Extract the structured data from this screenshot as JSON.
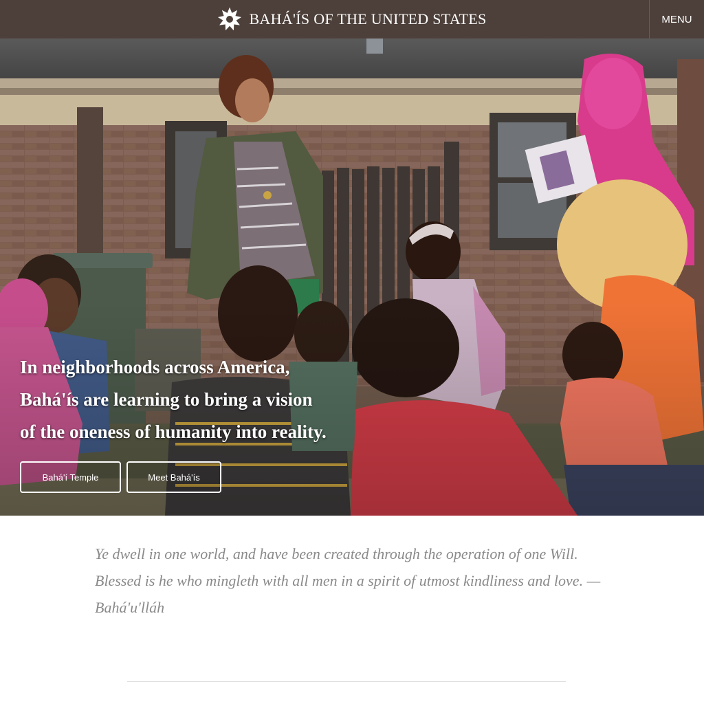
{
  "header": {
    "brand_icon": "nine-pointed-star-icon",
    "brand_title": "BAHÁ'ÍS OF THE UNITED STATES",
    "menu_label": "MENU",
    "background_color": "#4d403a"
  },
  "hero": {
    "headline_lines": [
      "In neighborhoods across America,",
      "Bahá'ís are learning to bring a vision",
      "of the oneness of humanity into reality."
    ],
    "buttons": [
      {
        "label": "Bahá'í Temple"
      },
      {
        "label": "Meet Bahá'ís"
      }
    ]
  },
  "quote": {
    "lines": [
      "Ye dwell in one world, and have been created through the operation of one Will.",
      "Blessed is he who mingleth with all men in a spirit of utmost kindliness and love. —",
      "Bahá'u'lláh"
    ],
    "text_color": "#8a8a8a"
  }
}
